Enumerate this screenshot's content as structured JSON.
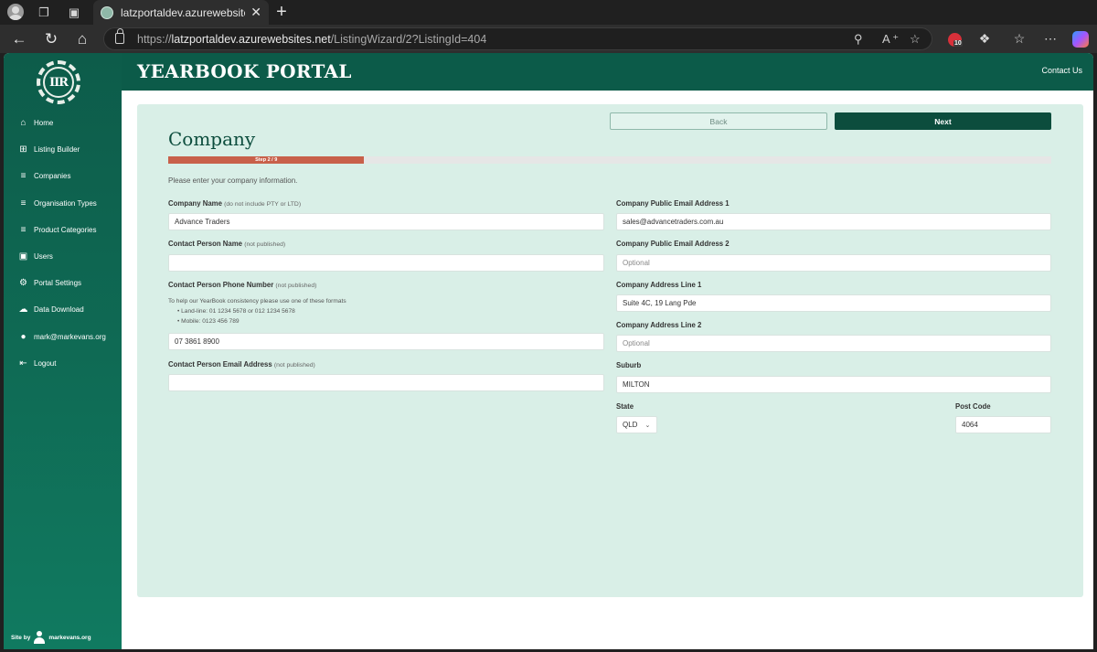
{
  "browser": {
    "tab_title": "latzportaldev.azurewebsites.net/L",
    "url_scheme": "https://",
    "url_host": "latzportaldev.azurewebsites.net",
    "url_path": "/ListingWizard/2?ListingId=404",
    "extension_badge": "10"
  },
  "header": {
    "brand": "YEARBOOK PORTAL",
    "contact": "Contact Us"
  },
  "logo": {
    "text": "IIR"
  },
  "sidebar": {
    "items": [
      {
        "label": "Home",
        "icon": "home-icon"
      },
      {
        "label": "Listing Builder",
        "icon": "plus-box-icon"
      },
      {
        "label": "Companies",
        "icon": "list-icon"
      },
      {
        "label": "Organisation Types",
        "icon": "list-icon"
      },
      {
        "label": "Product Categories",
        "icon": "list-icon"
      },
      {
        "label": "Users",
        "icon": "user-box-icon"
      },
      {
        "label": "Portal Settings",
        "icon": "gear-icon"
      },
      {
        "label": "Data Download",
        "icon": "cloud-download-icon"
      },
      {
        "label": "mark@markevans.org",
        "icon": "user-icon"
      },
      {
        "label": "Logout",
        "icon": "logout-icon"
      }
    ],
    "site_by_prefix": "Site by",
    "site_by_name": "markevans.org"
  },
  "wizard": {
    "back_label": "Back",
    "next_label": "Next",
    "title": "Company",
    "step_text": "Step 2 / 9",
    "progress_fraction": 0.222,
    "intro": "Please enter your company information."
  },
  "form": {
    "company_name": {
      "label": "Company Name",
      "note": "(do not include PTY or LTD)",
      "value": "Advance Traders"
    },
    "contact_name": {
      "label": "Contact Person Name",
      "note": "(not published)",
      "value": ""
    },
    "contact_phone": {
      "label": "Contact Person Phone Number",
      "note": "(not published)",
      "help": "To help our YearBook consistency please use one of these formats",
      "formats": [
        "Land-line: 01 1234 5678 or 012 1234 5678",
        "Mobile: 0123 456 789"
      ],
      "value": "07 3861 8900"
    },
    "contact_email": {
      "label": "Contact Person Email Address",
      "note": "(not published)",
      "value": ""
    },
    "public_email_1": {
      "label": "Company Public Email Address 1",
      "value": "sales@advancetraders.com.au"
    },
    "public_email_2": {
      "label": "Company Public Email Address 2",
      "placeholder": "Optional"
    },
    "address_1": {
      "label": "Company Address Line 1",
      "value": "Suite 4C, 19 Lang Pde"
    },
    "address_2": {
      "label": "Company Address Line 2",
      "placeholder": "Optional"
    },
    "suburb": {
      "label": "Suburb",
      "value": "MILTON"
    },
    "state": {
      "label": "State",
      "value": "QLD"
    },
    "postcode": {
      "label": "Post Code",
      "value": "4064"
    }
  }
}
